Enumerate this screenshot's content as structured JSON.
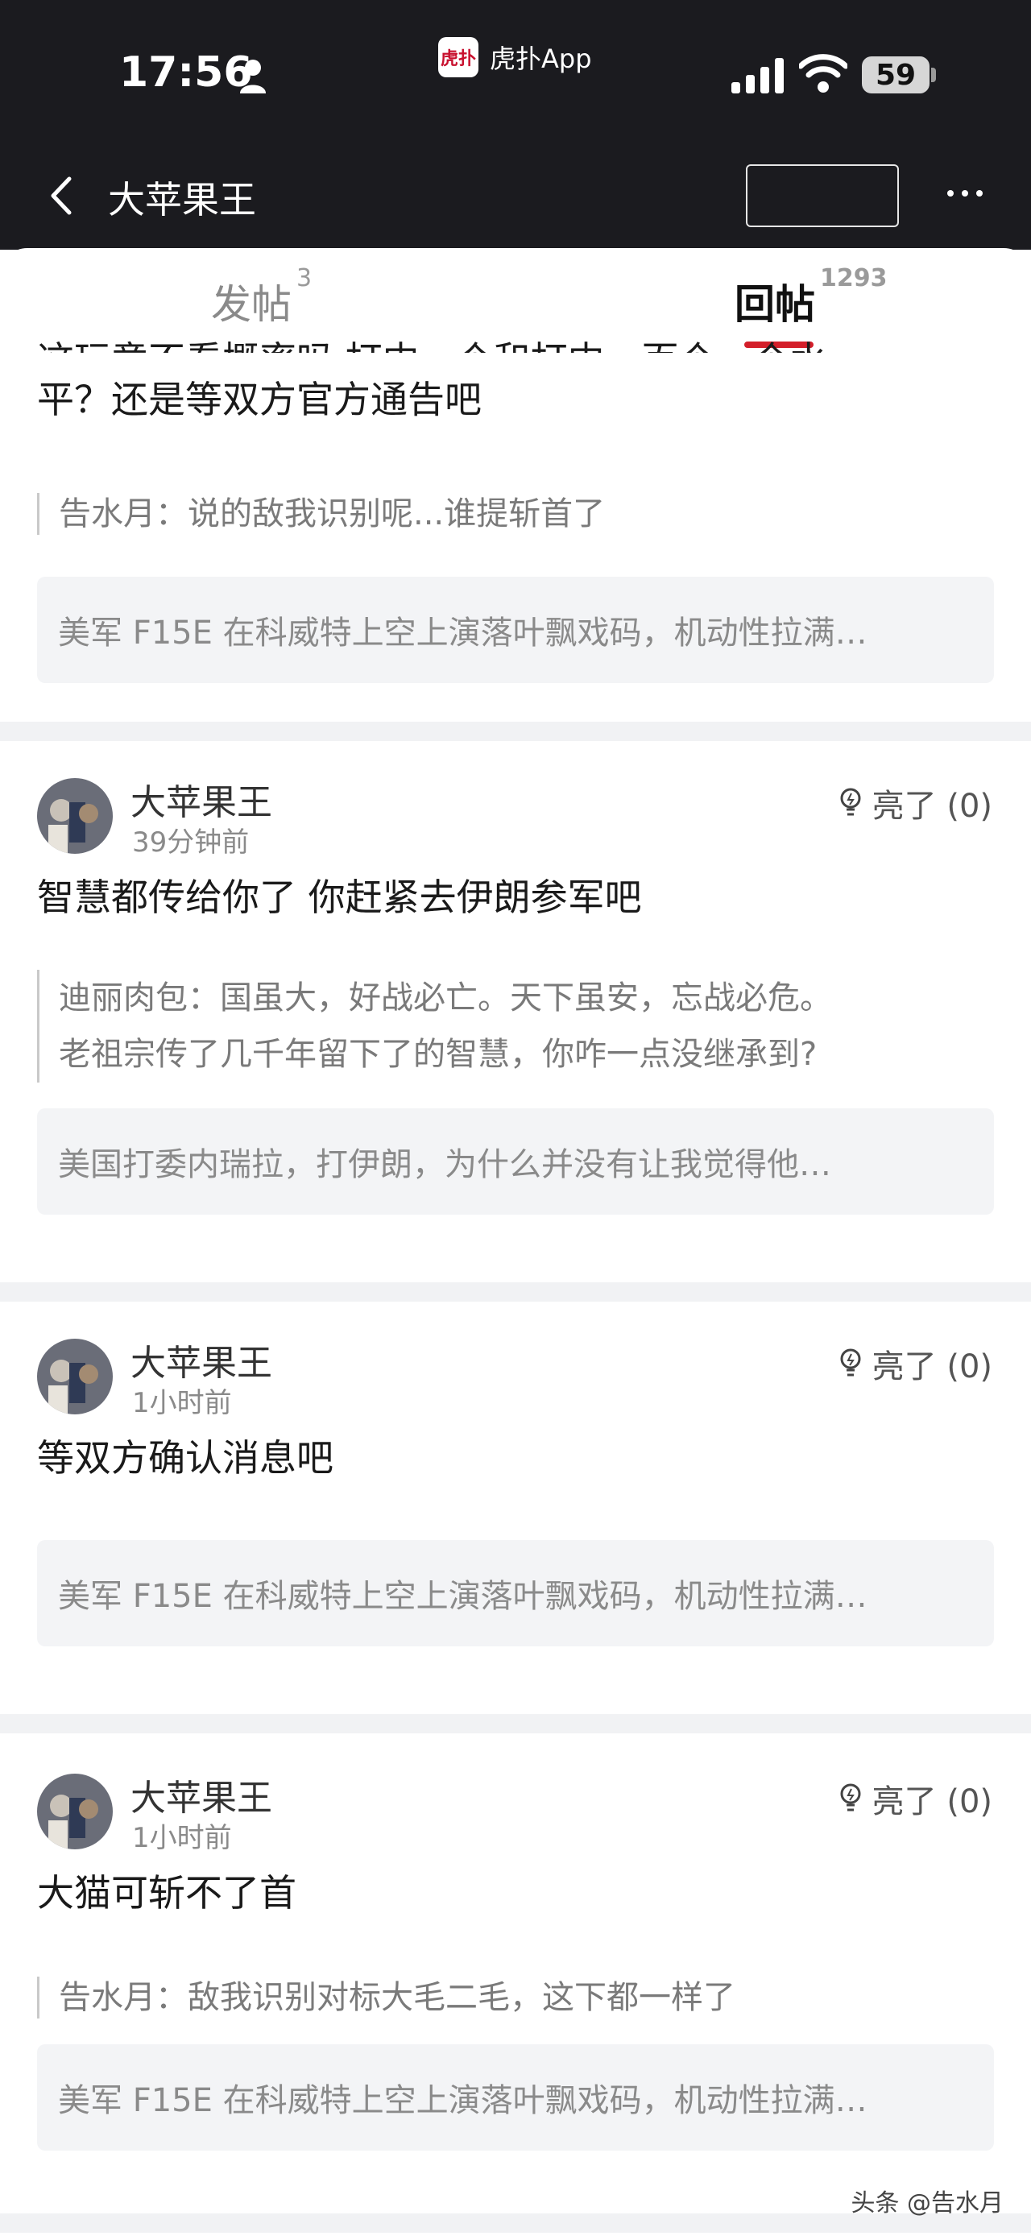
{
  "status": {
    "time": "17:56",
    "app_label": "虎扑App",
    "app_logo": "虎扑",
    "battery": "59"
  },
  "nav": {
    "title": "大苹果王"
  },
  "tabs": [
    {
      "label": "发帖",
      "count": "3"
    },
    {
      "label": "回帖",
      "count": "1293"
    }
  ],
  "first": {
    "cut_text": "这玩意不看概率吗 打中一个和打中一百个一个水",
    "text": "平？还是等双方官方通告吧",
    "quote": "告水月：说的敌我识别呢...谁提斩首了",
    "ref": "美军 F15E 在科威特上空上演落叶飘戏码，机动性拉满…"
  },
  "posts": [
    {
      "user": "大苹果王",
      "time": "39分钟前",
      "like": "亮了 (0)",
      "text": "智慧都传给你了 你赶紧去伊朗参军吧",
      "quote_1": "迪丽肉包：国虽大，好战必亡。天下虽安，忘战必危。",
      "quote_2": "老祖宗传了几千年留下了的智慧，你咋一点没继承到?",
      "ref": "美国打委内瑞拉，打伊朗，为什么并没有让我觉得他…"
    },
    {
      "user": "大苹果王",
      "time": "1小时前",
      "like": "亮了 (0)",
      "text": "等双方确认消息吧",
      "ref": "美军 F15E 在科威特上空上演落叶飘戏码，机动性拉满…"
    },
    {
      "user": "大苹果王",
      "time": "1小时前",
      "like": "亮了 (0)",
      "text": "大猫可斩不了首",
      "quote_1": "告水月：敌我识别对标大毛二毛，这下都一样了",
      "ref": "美军 F15E 在科威特上空上演落叶飘戏码，机动性拉满…"
    }
  ],
  "watermark": "头条 @告水月"
}
